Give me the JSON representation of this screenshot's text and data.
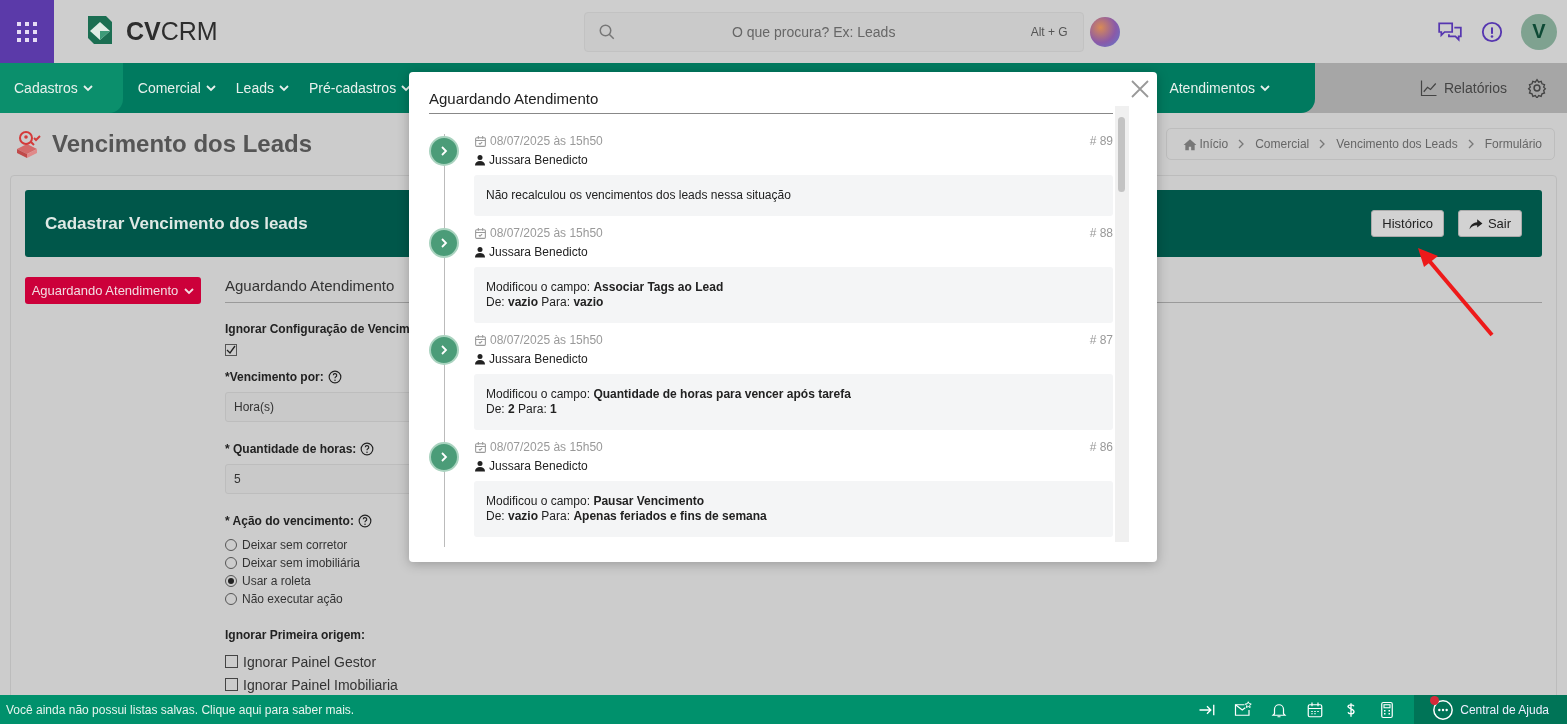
{
  "topbar": {
    "logo": "**CV**CRM",
    "search": {
      "placeholder": "O que procura? Ex: Leads",
      "shortcut": "Alt + G"
    },
    "avatar": "V"
  },
  "nav": {
    "items": [
      {
        "label": "Cadastros",
        "selected": true
      },
      {
        "label": "Comercial",
        "selected": false
      },
      {
        "label": "Leads",
        "selected": false
      },
      {
        "label": "Pré-cadastros",
        "selected": false
      },
      {
        "label": "Atendimentos",
        "selected": false
      }
    ],
    "reports": "Relatórios"
  },
  "page": {
    "title": "Vencimento dos Leads",
    "breadcrumb": [
      "Início",
      "Comercial",
      "Vencimento dos Leads",
      "Formulário"
    ]
  },
  "card": {
    "title": "Cadastrar Vencimento dos leads",
    "buttons": [
      {
        "label": "Histórico",
        "kind": "plain"
      },
      {
        "label": "Sair",
        "kind": "exit"
      }
    ]
  },
  "form": {
    "status_button": "Aguardando Atendimento",
    "section_title": "Aguardando Atendimento",
    "ignore_config": {
      "label": "Ignorar Configuração de Vencim",
      "checked": true
    },
    "due_by": {
      "label": "*Vencimento por:",
      "value": "Hora(s)"
    },
    "hours": {
      "label": "* Quantidade de horas:",
      "value": "5"
    },
    "action": {
      "label": "* Ação do vencimento:",
      "options": [
        {
          "label": "Deixar sem corretor",
          "selected": false
        },
        {
          "label": "Deixar sem imobiliária",
          "selected": false
        },
        {
          "label": "Usar a roleta",
          "selected": true
        },
        {
          "label": "Não executar ação",
          "selected": false
        }
      ]
    },
    "ignore_origin": {
      "label": "Ignorar Primeira origem:",
      "options": [
        {
          "label": "Ignorar Painel Gestor",
          "checked": false
        },
        {
          "label": "Ignorar Painel Imobiliaria",
          "checked": false
        }
      ]
    }
  },
  "modal": {
    "title": "Aguardando Atendimento",
    "entries": [
      {
        "date": "08/07/2025 às 15h50",
        "number": "# 89",
        "author": "Jussara Benedicto",
        "lines": [
          "Não recalculou os vencimentos dos leads nessa situação"
        ]
      },
      {
        "date": "08/07/2025 às 15h50",
        "number": "# 88",
        "author": "Jussara Benedicto",
        "lines": [
          "Modificou o campo: **Associar Tags ao Lead**",
          "De: **vazio** Para: **vazio**"
        ]
      },
      {
        "date": "08/07/2025 às 15h50",
        "number": "# 87",
        "author": "Jussara Benedicto",
        "lines": [
          "Modificou o campo: **Quantidade de horas para vencer após tarefa**",
          "De: **2** Para: **1**"
        ]
      },
      {
        "date": "08/07/2025 às 15h50",
        "number": "# 86",
        "author": "Jussara Benedicto",
        "lines": [
          "Modificou o campo: **Pausar Vencimento**",
          "De: **vazio** Para: **Apenas feriados e fins de semana**"
        ]
      }
    ]
  },
  "footer": {
    "message": "Você ainda não possui listas salvas. Clique aqui para saber mais.",
    "help": "Central de Ajuda"
  }
}
